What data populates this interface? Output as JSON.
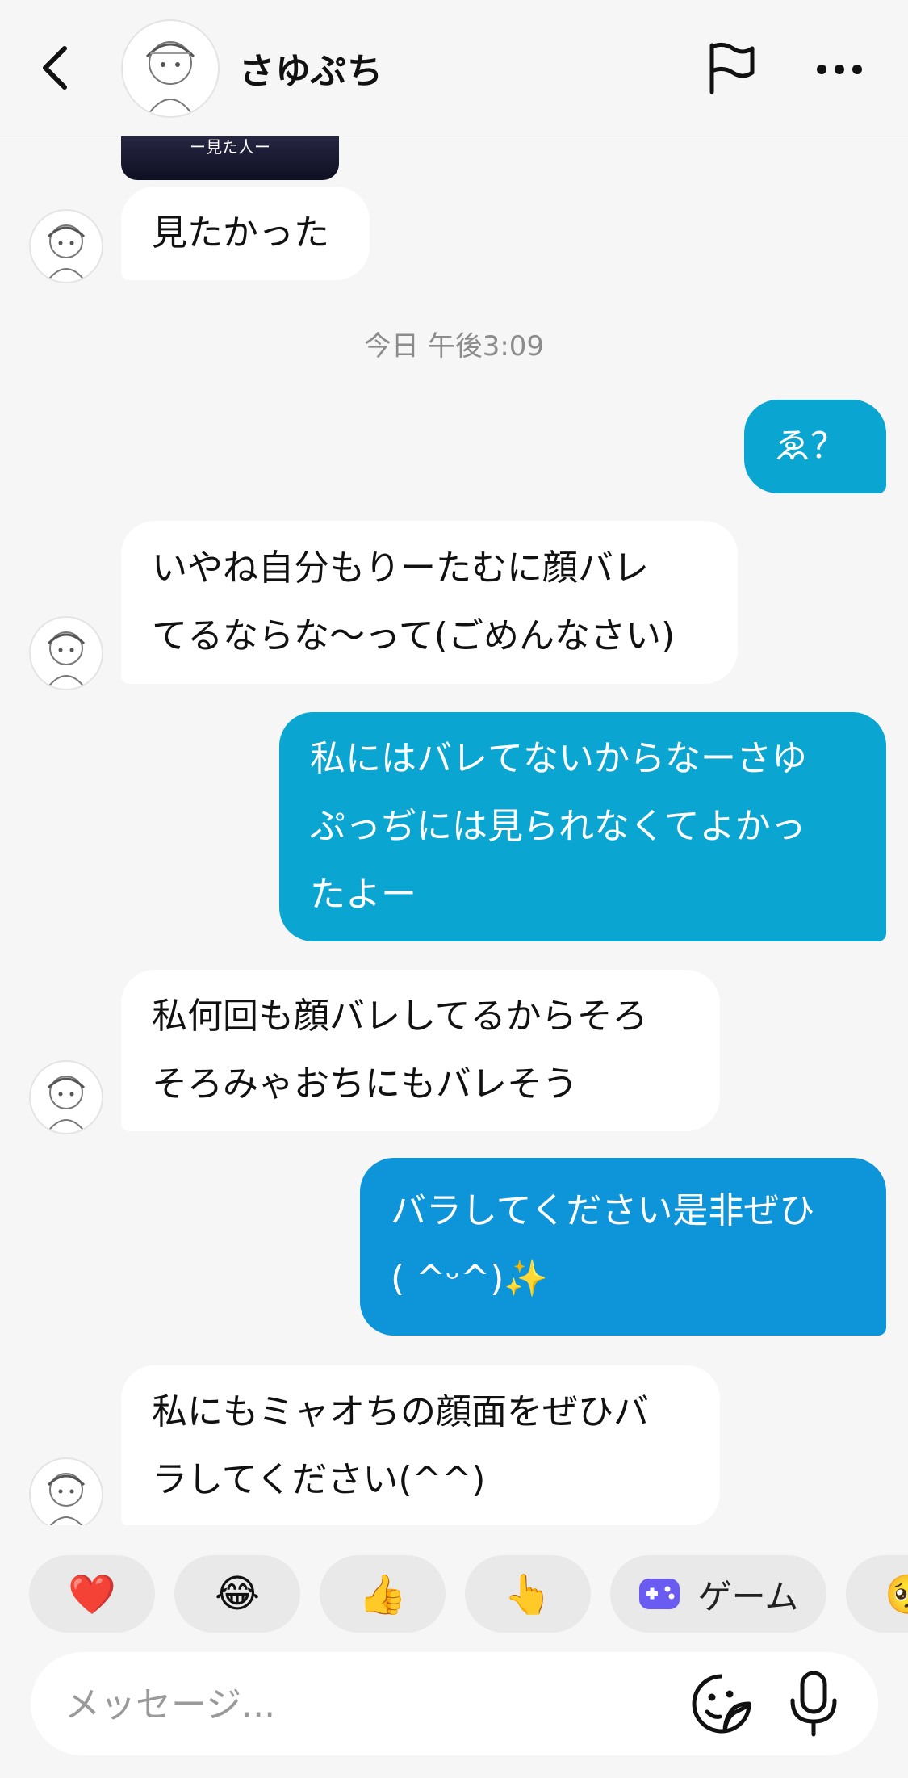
{
  "header": {
    "contact_name": "さゆぷち",
    "back_icon": "chevron-left-icon",
    "flag_icon": "flag-icon",
    "more_icon": "more-horizontal-icon"
  },
  "image_card": {
    "caption": "ー見た人ー"
  },
  "messages": [
    {
      "side": "in",
      "lines": [
        "見たかった"
      ]
    },
    {
      "side": "out",
      "lines": [
        "ゑ？"
      ]
    },
    {
      "side": "in",
      "lines": [
        "いやね自分もりーたむに顔バレ",
        "てるならな〜って(ごめんなさい)"
      ]
    },
    {
      "side": "out",
      "lines": [
        "私にはバレてないからなーさゆ",
        "ぷっぢには見られなくてよかっ",
        "たよー"
      ]
    },
    {
      "side": "in",
      "lines": [
        "私何回も顔バレしてるからそろ",
        "そろみゃおちにもバレそう"
      ]
    },
    {
      "side": "out",
      "lines": [
        "バラしてください是非ぜひ",
        "( ^ᵕ^)✨"
      ]
    },
    {
      "side": "in",
      "lines": [
        "私にもミャオちの顔面をぜひバ",
        "ラしてください(^^)"
      ]
    }
  ],
  "timestamp": "今日 午後3:09",
  "quick_replies": [
    {
      "emoji": "❤️",
      "icon": "heart-icon"
    },
    {
      "emoji": "😂",
      "icon": "laughing-face-icon"
    },
    {
      "emoji": "👍",
      "icon": "thumbs-up-icon"
    },
    {
      "emoji": "👆",
      "icon": "pointing-up-icon"
    },
    {
      "icon": "gamepad-icon",
      "label": "ゲーム"
    },
    {
      "emoji": "🥺",
      "icon": "face-icon"
    }
  ],
  "composer": {
    "placeholder": "メッセージ...",
    "sticker_icon": "sticker-face-icon",
    "mic_icon": "microphone-icon"
  },
  "colors": {
    "outgoing_bubble": "#0aa5d1",
    "outgoing_bubble_alt": "#0e94d8",
    "incoming_bubble": "#ffffff",
    "background": "#f6f6f6"
  }
}
